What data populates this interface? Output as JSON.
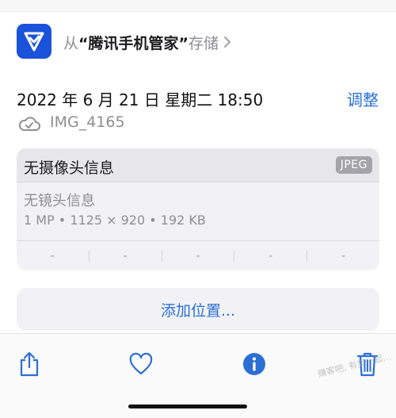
{
  "source": {
    "prefix": "从",
    "app_name": "“腾讯手机管家”",
    "suffix": "存储",
    "icon": "shield-check-icon",
    "icon_color": "#1a52d9"
  },
  "datetime": "2022 年 6 月 21 日  星期二  18:50",
  "adjust_label": "调整",
  "file": {
    "cloud_icon": "cloud-icon",
    "name": "IMG_4165"
  },
  "metadata": {
    "camera": "无摄像头信息",
    "format": "JPEG",
    "lens": "无镜头信息",
    "specs": "1 MP • 1125 × 920 • 192 KB",
    "exif": [
      "-",
      "-",
      "-",
      "-",
      "-"
    ]
  },
  "add_location_label": "添加位置...",
  "toolbar": {
    "share_icon": "share-icon",
    "favorite_icon": "heart-icon",
    "info_icon": "info-icon",
    "delete_icon": "trash-icon",
    "accent": "#2b6fd6"
  },
  "watermark": "赚客吧, 有奖一起..."
}
